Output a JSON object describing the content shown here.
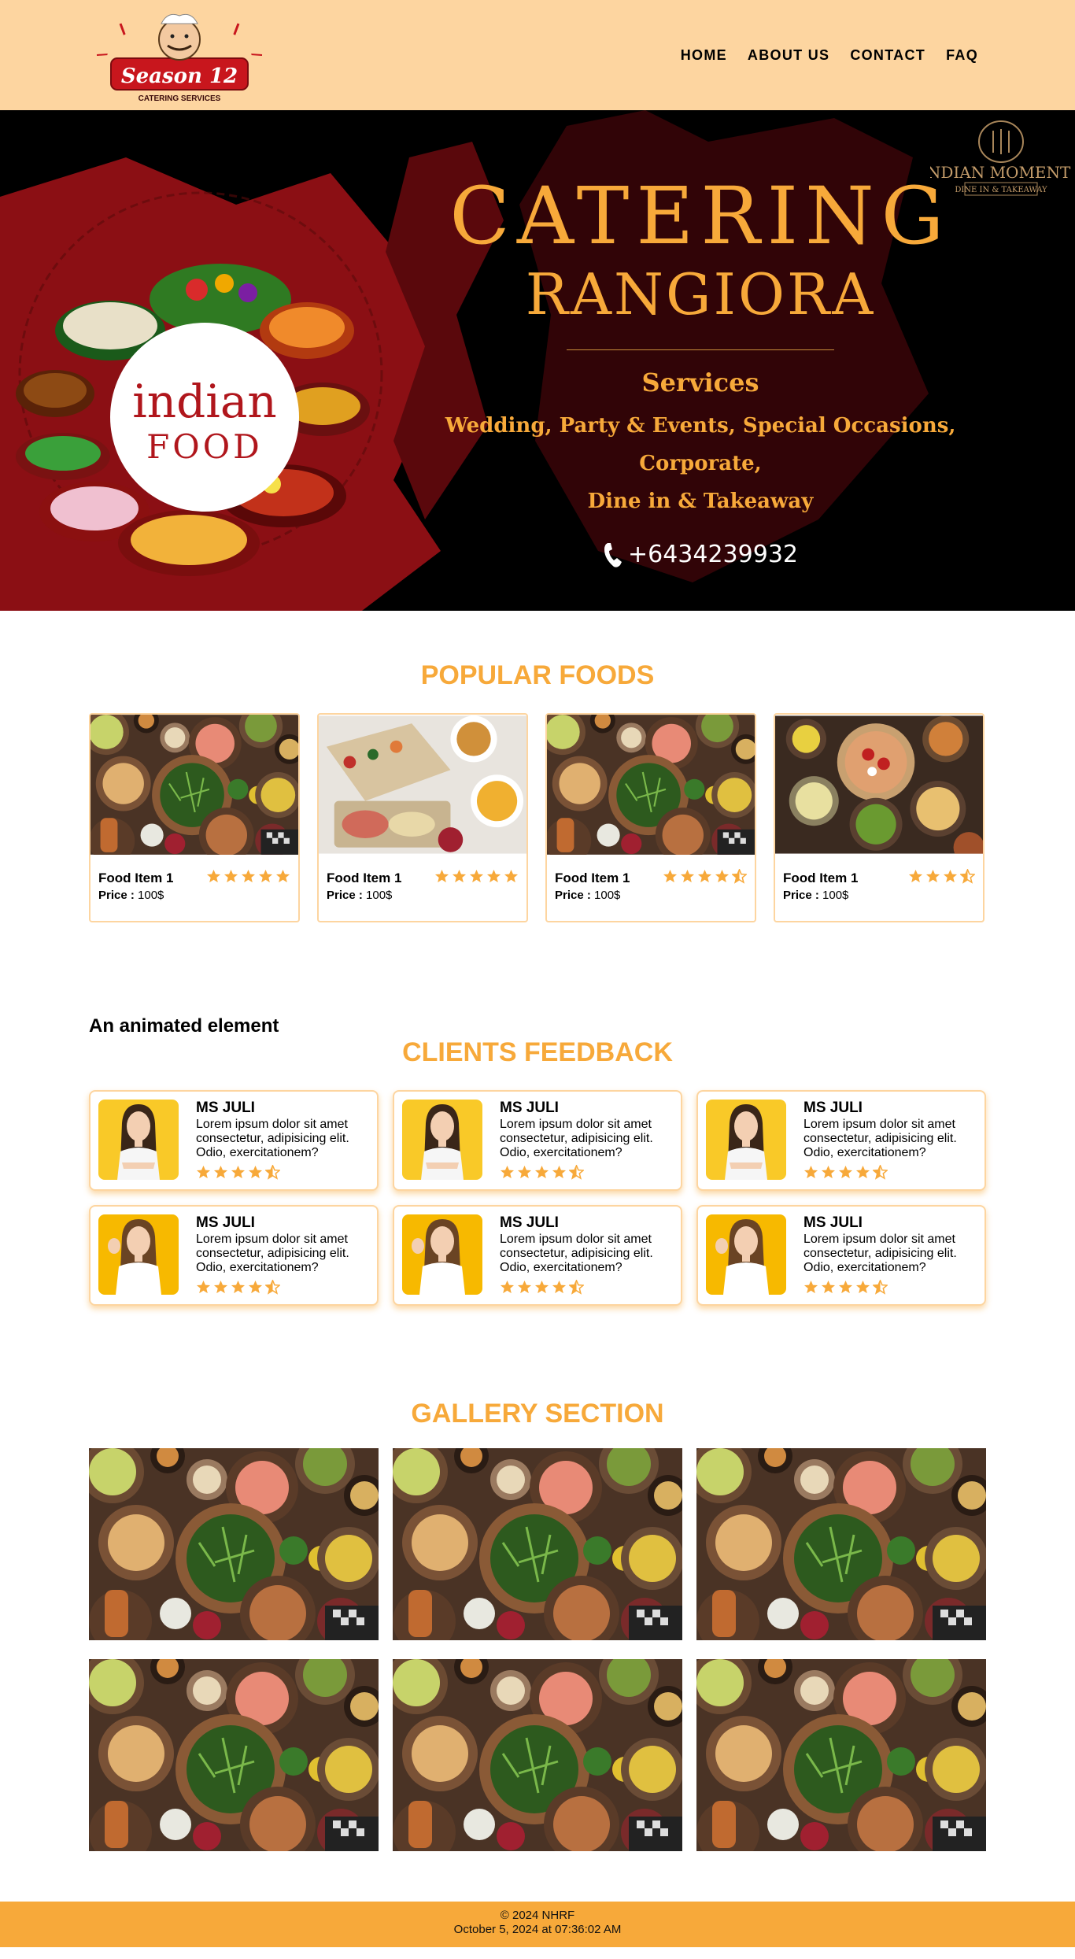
{
  "brand": {
    "logo_text": "Season 12",
    "logo_tagline": "CATERING SERVICES"
  },
  "nav": {
    "items": [
      "HOME",
      "ABOUT US",
      "CONTACT",
      "FAQ"
    ]
  },
  "hero": {
    "badge_text": "indian FOOD",
    "badge_line1": "indian",
    "badge_line2": "FOOD",
    "title": "CATERING",
    "subtitle": "RANGIORA",
    "services_label": "Services",
    "services_line1": "Wedding, Party & Events, Special Occasions, Corporate,",
    "services_line2": "Dine in & Takeaway",
    "phone": "+6434239932",
    "corner_logo_title": "INDIAN MOMENTS",
    "corner_logo_sub": "DINE IN & TAKEAWAY"
  },
  "popular": {
    "title": "POPULAR FOODS",
    "price_label": "Price :",
    "items": [
      {
        "name": "Food Item 1",
        "price": "100$",
        "rating": 5
      },
      {
        "name": "Food Item 1",
        "price": "100$",
        "rating": 5
      },
      {
        "name": "Food Item 1",
        "price": "100$",
        "rating": 4.5
      },
      {
        "name": "Food Item 1",
        "price": "100$",
        "rating": 3.5
      }
    ]
  },
  "animated_label": "An animated element",
  "feedback": {
    "title": "CLIENTS FEEDBACK",
    "items": [
      {
        "name": "MS JULI",
        "text": "Lorem ipsum dolor sit amet consectetur, adipisicing elit. Odio, exercitationem?",
        "rating": 4.5
      },
      {
        "name": "MS JULI",
        "text": "Lorem ipsum dolor sit amet consectetur, adipisicing elit. Odio, exercitationem?",
        "rating": 4.5
      },
      {
        "name": "MS JULI",
        "text": "Lorem ipsum dolor sit amet consectetur, adipisicing elit. Odio, exercitationem?",
        "rating": 4.5
      },
      {
        "name": "MS JULI",
        "text": "Lorem ipsum dolor sit amet consectetur, adipisicing elit. Odio, exercitationem?",
        "rating": 4.5
      },
      {
        "name": "MS JULI",
        "text": "Lorem ipsum dolor sit amet consectetur, adipisicing elit. Odio, exercitationem?",
        "rating": 4.5
      },
      {
        "name": "MS JULI",
        "text": "Lorem ipsum dolor sit amet consectetur, adipisicing elit. Odio, exercitationem?",
        "rating": 4.5
      }
    ]
  },
  "gallery": {
    "title": "GALLERY SECTION",
    "image_count": 6
  },
  "footer": {
    "copyright": "© 2024 NHRF",
    "timestamp": "October 5, 2024 at 07:36:02 AM"
  },
  "colors": {
    "accent": "#f7a93a",
    "nav_bg": "#fdd5a0",
    "hero_bg": "#000000",
    "hero_red": "#8b0f14"
  }
}
